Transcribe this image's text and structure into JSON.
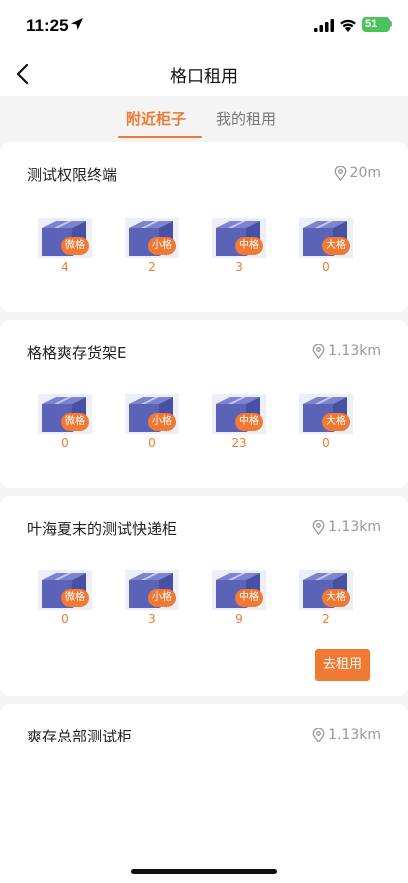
{
  "status_bar": {
    "time": "11:25",
    "battery": "51"
  },
  "nav": {
    "title": "格口租用"
  },
  "tabs": [
    {
      "label": "附近柜子",
      "active": true
    },
    {
      "label": "我的租用",
      "active": false
    }
  ],
  "size_labels": [
    "微格",
    "小格",
    "中格",
    "大格"
  ],
  "cabinets": [
    {
      "name": "测试权限终端",
      "distance": "20m",
      "counts": [
        "4",
        "2",
        "3",
        "0"
      ]
    },
    {
      "name": "格格爽存货架E",
      "distance": "1.13km",
      "counts": [
        "0",
        "0",
        "23",
        "0"
      ]
    },
    {
      "name": "叶海夏末的测试快递柜",
      "distance": "1.13km",
      "counts": [
        "0",
        "3",
        "9",
        "2"
      ],
      "action": "去租用"
    },
    {
      "name": "爽存总部测试柜",
      "distance": "1.13km"
    }
  ],
  "colors": {
    "accent": "#f07a33",
    "box": "#5a63b8",
    "battery": "#49c35a"
  }
}
